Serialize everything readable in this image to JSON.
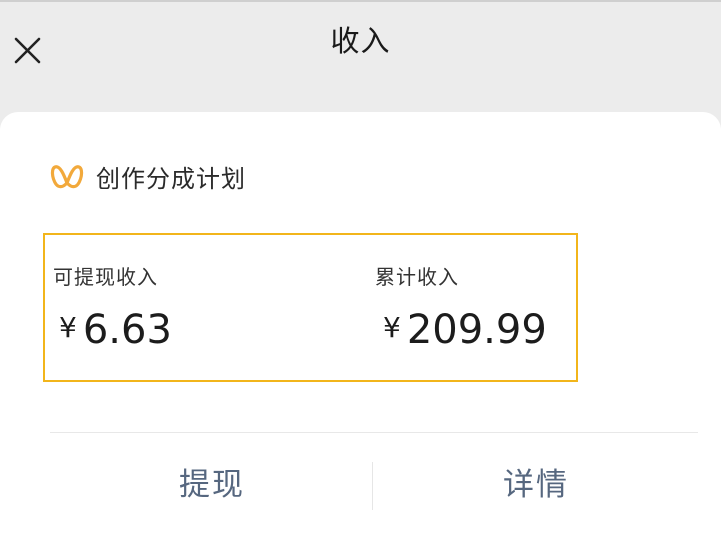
{
  "header": {
    "title": "收入",
    "close_icon": "close-icon"
  },
  "plan": {
    "icon": "program-logo-icon",
    "label": "创作分成计划",
    "logo_color": "#f2a93b"
  },
  "income": {
    "withdrawable": {
      "label": "可提现收入",
      "currency": "¥",
      "amount": "6.63"
    },
    "cumulative": {
      "label": "累计收入",
      "currency": "¥",
      "amount": "209.99"
    },
    "box_border_color": "#f2b51b"
  },
  "actions": {
    "withdraw_label": "提现",
    "details_label": "详情",
    "color": "#56677f"
  }
}
